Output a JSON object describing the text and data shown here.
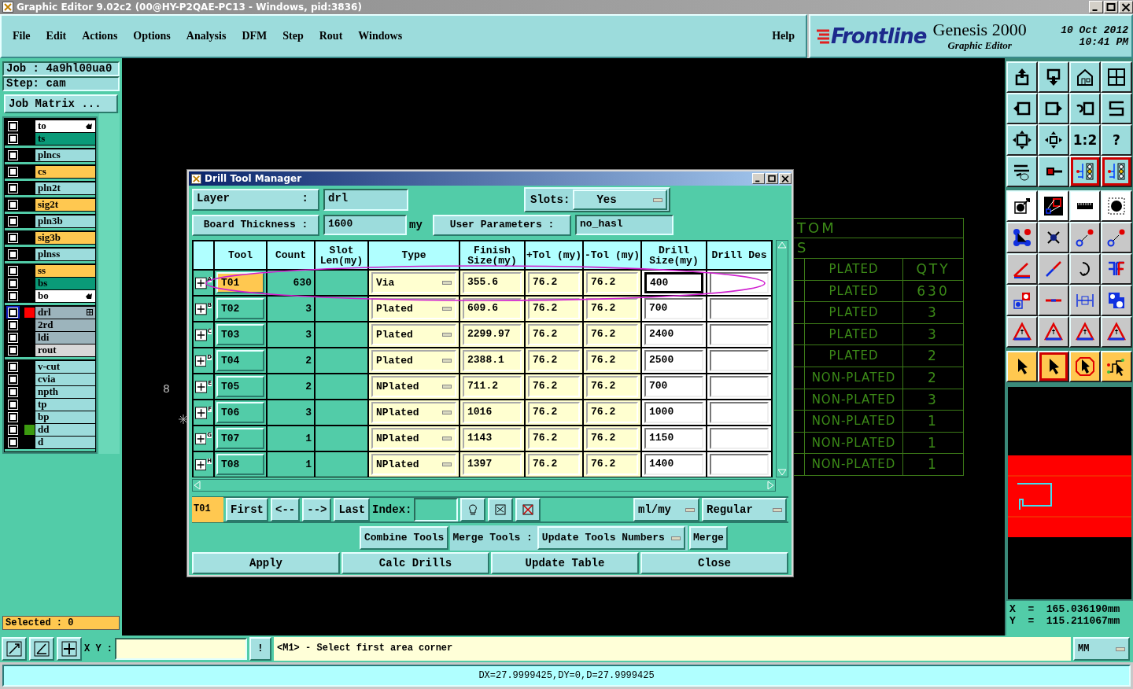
{
  "window": {
    "title": "Graphic Editor 9.02c2 (00@HY-P2QAE-PC13 - Windows, pid:3836)"
  },
  "menu": {
    "items": [
      "File",
      "Edit",
      "Actions",
      "Options",
      "Analysis",
      "DFM",
      "Step",
      "Rout",
      "Windows"
    ],
    "help": "Help"
  },
  "brand": {
    "logo": "Frontline",
    "product": "Genesis 2000",
    "subtitle": "Graphic Editor",
    "date": "10  Oct  2012",
    "time": "10:41  PM"
  },
  "job_panel": {
    "job": "Job : 4a9hl00ua0",
    "step": "Step: cam",
    "button": "Job Matrix ..."
  },
  "layer_groups": [
    {
      "items": [
        {
          "name": "to",
          "color": "#ffffff",
          "active": false,
          "kind": "pointer"
        },
        {
          "name": "ts",
          "color": "#0a9a78",
          "active": false
        }
      ]
    },
    {
      "items": [
        {
          "name": "plncs",
          "color": "#9cdcdc",
          "active": false
        }
      ]
    },
    {
      "items": [
        {
          "name": "cs",
          "color": "#ffc850",
          "active": false
        }
      ]
    },
    {
      "items": [
        {
          "name": "pln2t",
          "color": "#9cdcdc",
          "active": false
        }
      ]
    },
    {
      "items": [
        {
          "name": "sig2t",
          "color": "#ffc850",
          "active": false
        }
      ]
    },
    {
      "items": [
        {
          "name": "pln3b",
          "color": "#9cdcdc",
          "active": false
        }
      ]
    },
    {
      "items": [
        {
          "name": "sig3b",
          "color": "#ffc850",
          "active": false
        }
      ]
    },
    {
      "items": [
        {
          "name": "plnss",
          "color": "#9cdcdc",
          "active": false
        }
      ]
    },
    {
      "items": [
        {
          "name": "ss",
          "color": "#ffc850",
          "active": false
        },
        {
          "name": "bs",
          "color": "#0a9a78",
          "active": false
        },
        {
          "name": "bo",
          "color": "#ffffff",
          "active": false,
          "kind": "pointer"
        }
      ]
    },
    {
      "items": [
        {
          "name": "drl",
          "color": "#9cb4bc",
          "active": true,
          "swatch": {
            "color": "#ff0000"
          },
          "kind": "grid"
        },
        {
          "name": "2rd",
          "color": "#9cb4bc",
          "active": false
        },
        {
          "name": "ldi",
          "color": "#9cb4bc",
          "active": false
        },
        {
          "name": "rout",
          "color": "#d8d8d8",
          "active": false
        }
      ]
    },
    {
      "items": [
        {
          "name": "v-cut",
          "color": "#9cdcdc",
          "active": false
        },
        {
          "name": "cvia",
          "color": "#9cdcdc",
          "active": false
        },
        {
          "name": "npth",
          "color": "#9cdcdc",
          "active": false
        },
        {
          "name": "tp",
          "color": "#9cdcdc",
          "active": false
        },
        {
          "name": "bp",
          "color": "#9cdcdc",
          "active": false
        },
        {
          "name": "dd",
          "color": "#9cdcdc",
          "active": false,
          "swatch": {
            "color": "#3c9a10"
          }
        },
        {
          "name": "d",
          "color": "#9cdcdc",
          "active": false
        }
      ]
    }
  ],
  "selected_count": "Selected : 0",
  "canvas": {
    "label": "8",
    "drill_table": {
      "title_rows": [
        "TOM",
        "S"
      ],
      "header": [
        "PLATED",
        "QTY"
      ],
      "rows": [
        [
          "PLATED",
          "630"
        ],
        [
          "PLATED",
          "3"
        ],
        [
          "PLATED",
          "3"
        ],
        [
          "PLATED",
          "2"
        ],
        [
          "NON-PLATED",
          "2"
        ],
        [
          "NON-PLATED",
          "3"
        ],
        [
          "NON-PLATED",
          "1"
        ],
        [
          "NON-PLATED",
          "1"
        ],
        [
          "NON-PLATED",
          "1"
        ]
      ]
    }
  },
  "dialog": {
    "title": "Drill Tool Manager",
    "layer_label": [
      "Layer",
      ":"
    ],
    "layer": "drl",
    "slots_label": "Slots:",
    "slots": "Yes",
    "thickness_label": "Board Thickness :",
    "thickness": "1600",
    "thickness_unit": "my",
    "params_label": "User Parameters :",
    "params": "no_hasl",
    "columns": [
      "Tool",
      "Count",
      "Slot Len(my)",
      "Type",
      "Finish Size(my)",
      "+Tol (my)",
      "-Tol (my)",
      "Drill Size(my)",
      "Drill Des"
    ],
    "rows": [
      {
        "mark": "A",
        "tool": "T01",
        "count": "630",
        "type": "Via",
        "finish": "355.6",
        "plus_tol": "76.2",
        "minus_tol": "76.2",
        "drill_size": "400",
        "selected": true
      },
      {
        "mark": "B",
        "tool": "T02",
        "count": "3",
        "type": "Plated",
        "finish": "609.6",
        "plus_tol": "76.2",
        "minus_tol": "76.2",
        "drill_size": "700",
        "selected": false
      },
      {
        "mark": "C",
        "tool": "T03",
        "count": "3",
        "type": "Plated",
        "finish": "2299.97",
        "plus_tol": "76.2",
        "minus_tol": "76.2",
        "drill_size": "2400",
        "selected": false
      },
      {
        "mark": "D",
        "tool": "T04",
        "count": "2",
        "type": "Plated",
        "finish": "2388.1",
        "plus_tol": "76.2",
        "minus_tol": "76.2",
        "drill_size": "2500",
        "selected": false
      },
      {
        "mark": "E",
        "tool": "T05",
        "count": "2",
        "type": "NPlated",
        "finish": "711.2",
        "plus_tol": "76.2",
        "minus_tol": "76.2",
        "drill_size": "700",
        "selected": false
      },
      {
        "mark": "F",
        "tool": "T06",
        "count": "3",
        "type": "NPlated",
        "finish": "1016",
        "plus_tol": "76.2",
        "minus_tol": "76.2",
        "drill_size": "1000",
        "selected": false
      },
      {
        "mark": "G",
        "tool": "T07",
        "count": "1",
        "type": "NPlated",
        "finish": "1143",
        "plus_tol": "76.2",
        "minus_tol": "76.2",
        "drill_size": "1150",
        "selected": false
      },
      {
        "mark": "H",
        "tool": "T08",
        "count": "1",
        "type": "NPlated",
        "finish": "1397",
        "plus_tol": "76.2",
        "minus_tol": "76.2",
        "drill_size": "1400",
        "selected": false
      }
    ],
    "current": "T01",
    "nav": [
      "First",
      "<--",
      "-->",
      "Last"
    ],
    "index_label": "Index:",
    "units": "ml/my",
    "mode": "Regular",
    "combine": "Combine Tools",
    "merge_label": "Merge Tools :",
    "merge_mode": "Update Tools Numbers",
    "merge": "Merge",
    "buttons": [
      "Apply",
      "Calc Drills",
      "Update Table",
      "Close"
    ]
  },
  "toolbars": [
    {
      "kind": "view",
      "buttons": [
        {
          "kind": "up",
          "active": false
        },
        {
          "kind": "down",
          "active": false
        },
        {
          "kind": "house",
          "active": false
        },
        {
          "kind": "panes",
          "active": false
        },
        {
          "kind": "left",
          "active": false
        },
        {
          "kind": "right",
          "active": false
        },
        {
          "kind": "undo",
          "active": false
        },
        {
          "kind": "path",
          "active": false
        },
        {
          "kind": "fit",
          "active": false
        },
        {
          "kind": "pan",
          "active": false
        },
        {
          "kind": "text",
          "label": "1:2",
          "active": false
        },
        {
          "kind": "text",
          "label": "?",
          "active": false
        },
        {
          "kind": "tools",
          "active": false
        },
        {
          "kind": "probe",
          "active": false
        },
        {
          "kind": "lights",
          "active": true
        },
        {
          "kind": "lights",
          "active": true
        }
      ]
    },
    {
      "kind": "edit",
      "buttons": [
        {
          "kind": "dotarrow",
          "active": false
        },
        {
          "kind": "clip",
          "active": false
        },
        {
          "kind": "ruler",
          "active": false
        },
        {
          "kind": "dotframe",
          "active": false
        },
        {
          "kind": "nodes",
          "active": false
        },
        {
          "kind": "cross",
          "active": false
        },
        {
          "kind": "link",
          "active": false
        },
        {
          "kind": "link",
          "active": false
        },
        {
          "kind": "angle",
          "active": false
        },
        {
          "kind": "slash",
          "active": false
        },
        {
          "kind": "arc",
          "active": false
        },
        {
          "kind": "bars",
          "active": false
        },
        {
          "kind": "squares",
          "active": false
        },
        {
          "kind": "bar",
          "active": false
        },
        {
          "kind": "measure",
          "active": false
        },
        {
          "kind": "blobs",
          "active": false
        },
        {
          "kind": "triangle",
          "active": false
        },
        {
          "kind": "triangle",
          "active": false
        },
        {
          "kind": "triangle",
          "active": false
        },
        {
          "kind": "triangle",
          "active": false
        }
      ]
    },
    {
      "kind": "select",
      "buttons": [
        {
          "kind": "pointer",
          "active": false
        },
        {
          "kind": "pointer",
          "active": true
        },
        {
          "kind": "octpointer",
          "active": false
        },
        {
          "kind": "route",
          "active": false
        }
      ]
    }
  ],
  "coordinates": [
    "X  =  165.036190mm",
    "Y  =  115.211067mm"
  ],
  "command_bar": {
    "xy_label": "X Y :",
    "key": "!",
    "message": "<M1> - Select first area corner",
    "units": "MM"
  },
  "status_bar": "DX=27.9999425,DY=0,D=27.9999425"
}
